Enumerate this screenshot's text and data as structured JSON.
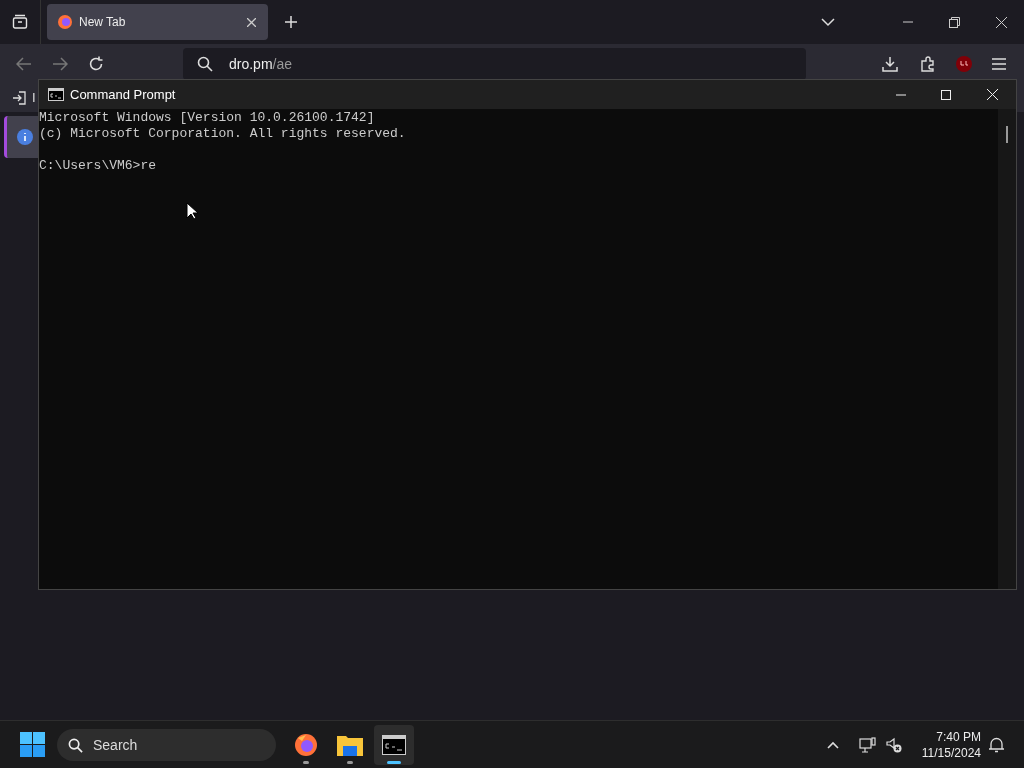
{
  "browser": {
    "tabs": [
      {
        "label": "New Tab",
        "selected": true
      }
    ],
    "address": {
      "host": "dro.pm",
      "path": "/ae"
    },
    "bookmark": {
      "label": "I"
    }
  },
  "console": {
    "title": "Command Prompt",
    "banner": [
      "Microsoft Windows [Version 10.0.26100.1742]",
      "(c) Microsoft Corporation. All rights reserved."
    ],
    "prompt": "C:\\Users\\VM6>re"
  },
  "taskbar": {
    "search": {
      "placeholder": "Search"
    },
    "apps": [
      {
        "kind": "firefox",
        "running": true,
        "selected": false
      },
      {
        "kind": "folder",
        "running": true,
        "selected": false
      },
      {
        "kind": "terminal",
        "running": true,
        "selected": true
      }
    ],
    "time": "7:40 PM",
    "date": "11/15/2024"
  }
}
